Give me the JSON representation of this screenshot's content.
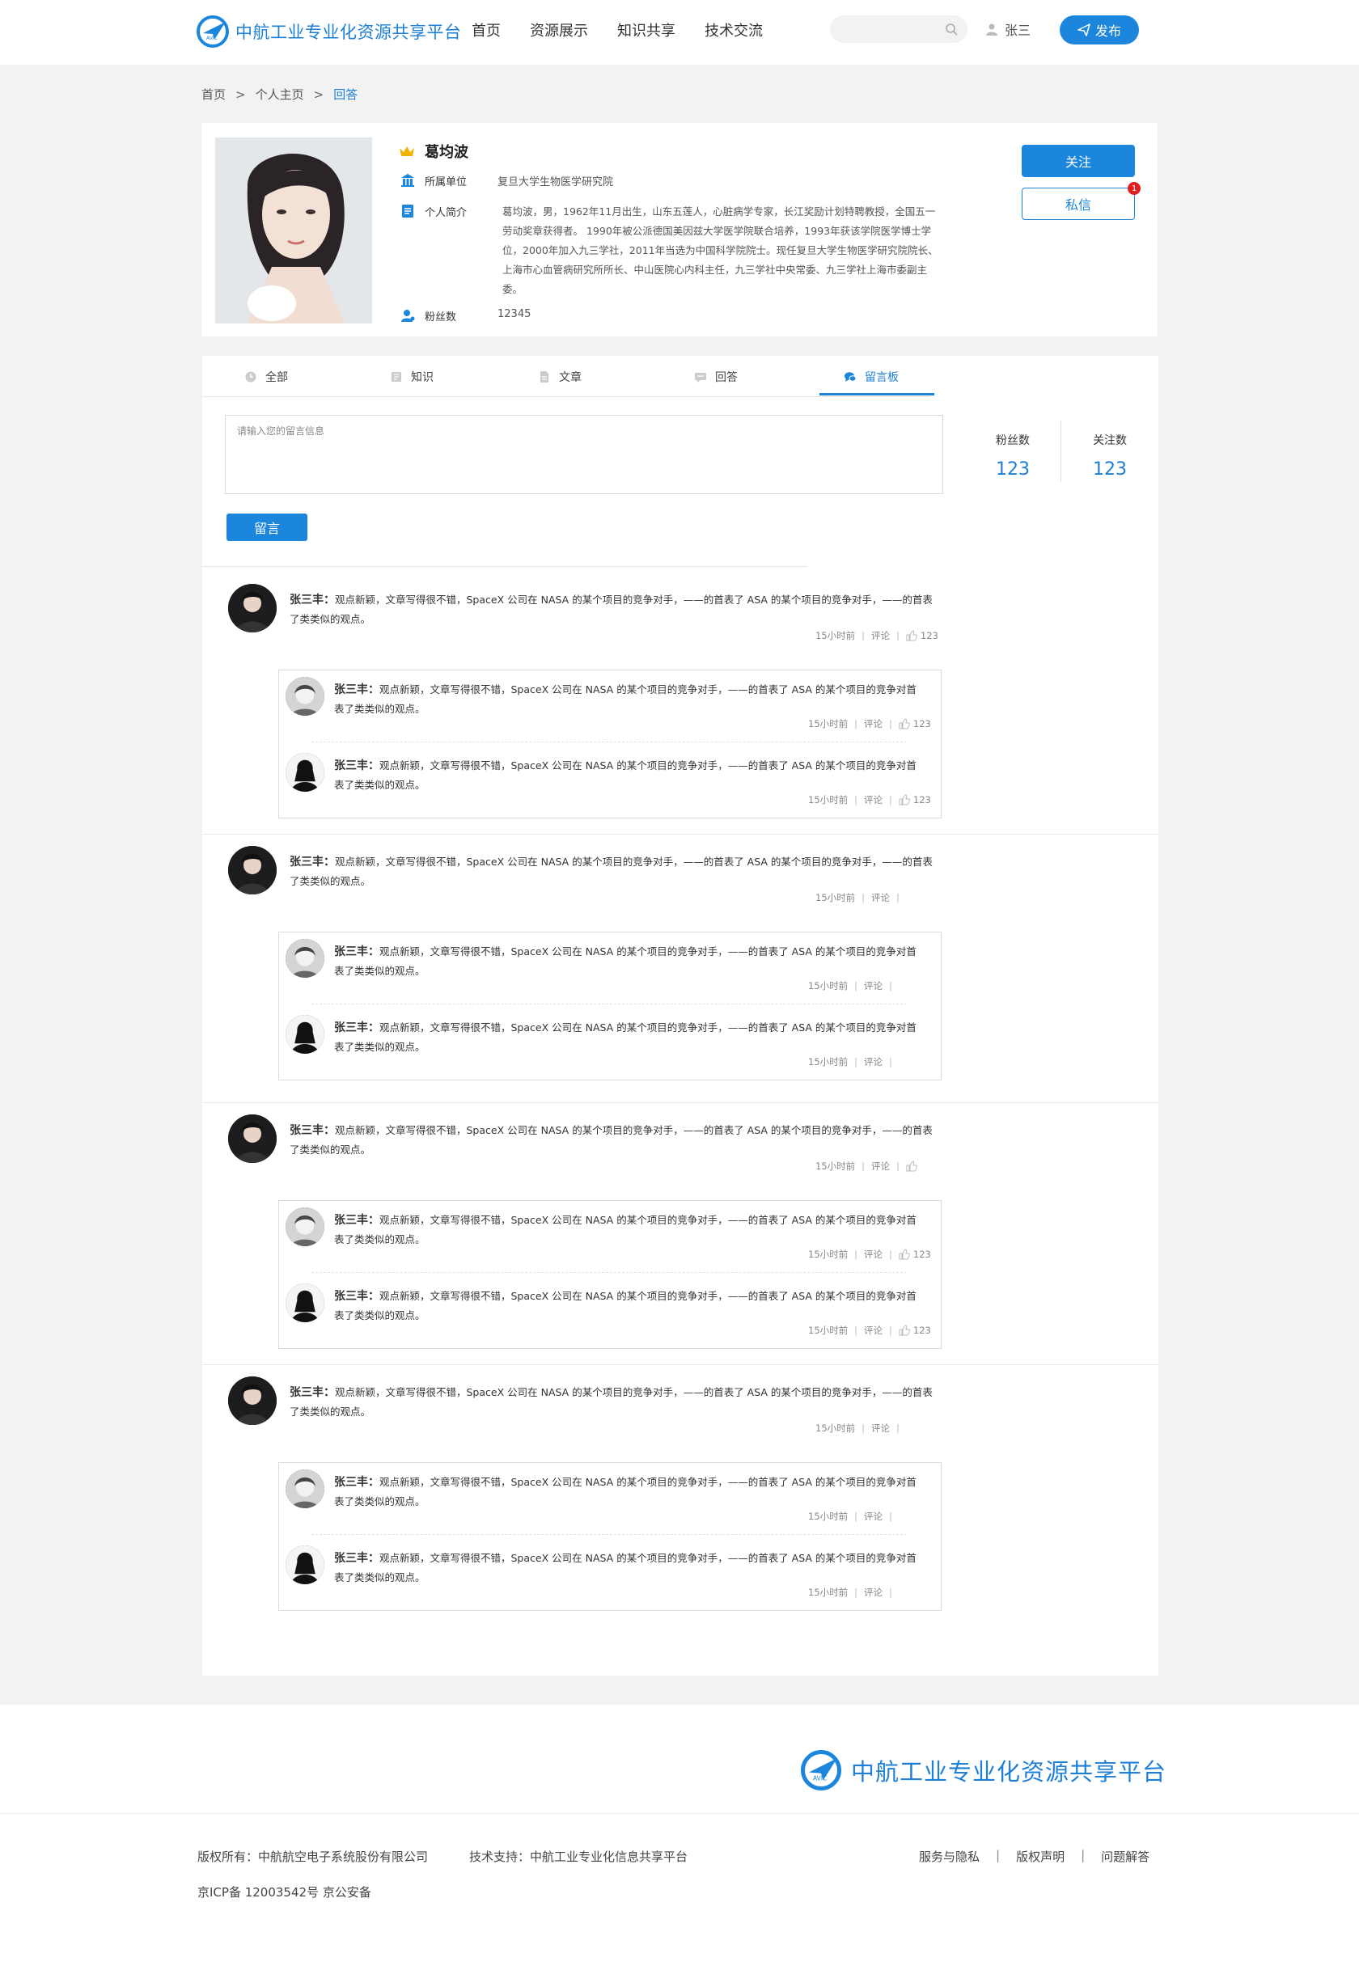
{
  "header": {
    "site_title": "中航工业专业化资源共享平台",
    "nav": [
      "首页",
      "资源展示",
      "知识共享",
      "技术交流"
    ],
    "search_placeholder": "",
    "user_name": "张三",
    "publish_label": "发布",
    "brand_color": "#1c86dd"
  },
  "breadcrumb": [
    "首页",
    "个人主页",
    "回答"
  ],
  "profile": {
    "name": "葛均波",
    "org_label": "所属单位",
    "org_value": "复旦大学生物医学研究院",
    "bio_label": "个人简介",
    "bio_value": "葛均波，男，1962年11月出生，山东五莲人，心脏病学专家，长江奖励计划特聘教授，全国五一劳动奖章获得者。 1990年被公派德国美因兹大学医学院联合培养，1993年获该学院医学博士学位，2000年加入九三学社，2011年当选为中国科学院院士。现任复旦大学生物医学研究院院长、上海市心血管病研究所所长、中山医院心内科主任，九三学社中央常委、九三学社上海市委副主委。",
    "fans_label": "粉丝数",
    "fans_value": "12345",
    "follow_label": "关注",
    "message_label": "私信",
    "message_badge": "1"
  },
  "tabs": [
    {
      "label": "全部",
      "icon": "clock-icon"
    },
    {
      "label": "知识",
      "icon": "book-icon"
    },
    {
      "label": "文章",
      "icon": "document-icon"
    },
    {
      "label": "回答",
      "icon": "answer-icon"
    },
    {
      "label": "留言板",
      "icon": "chat-bubble-icon",
      "active": true
    }
  ],
  "stats": [
    {
      "label": "粉丝数",
      "value": "123"
    },
    {
      "label": "关注数",
      "value": "123"
    }
  ],
  "message_board": {
    "placeholder": "请输入您的留言信息",
    "submit_label": "留言"
  },
  "comments": [
    {
      "author": "张三丰：",
      "text": "观点新颖，文章写得很不错，SpaceX 公司在 NASA 的某个项目的竞争对手，——的首表了 ASA 的某个项目的竞争对手，——的首表了类类似的观点。",
      "time": "15小时前",
      "comment_label": "评论",
      "likes": "123",
      "replies": [
        {
          "author": "张三丰：",
          "text": "观点新颖，文章写得很不错，SpaceX 公司在 NASA 的某个项目的竞争对手，——的首表了 ASA 的某个项目的竞争对首表了类类似的观点。",
          "time": "15小时前",
          "comment_label": "评论",
          "likes": "123"
        },
        {
          "author": "张三丰：",
          "text": "观点新颖，文章写得很不错，SpaceX 公司在 NASA 的某个项目的竞争对手，——的首表了 ASA 的某个项目的竞争对首表了类类似的观点。",
          "time": "15小时前",
          "comment_label": "评论",
          "likes": "123"
        }
      ]
    },
    {
      "author": "张三丰：",
      "text": "观点新颖，文章写得很不错，SpaceX 公司在 NASA 的某个项目的竞争对手，——的首表了 ASA 的某个项目的竞争对手，——的首表了类类似的观点。",
      "time": "15小时前",
      "comment_label": "评论",
      "likes": "",
      "replies": [
        {
          "author": "张三丰：",
          "text": "观点新颖，文章写得很不错，SpaceX 公司在 NASA 的某个项目的竞争对手，——的首表了 ASA 的某个项目的竞争对首表了类类似的观点。",
          "time": "15小时前",
          "comment_label": "评论",
          "likes": ""
        },
        {
          "author": "张三丰：",
          "text": "观点新颖，文章写得很不错，SpaceX 公司在 NASA 的某个项目的竞争对手，——的首表了 ASA 的某个项目的竞争对首表了类类似的观点。",
          "time": "15小时前",
          "comment_label": "评论",
          "likes": ""
        }
      ]
    },
    {
      "author": "张三丰：",
      "text": "观点新颖，文章写得很不错，SpaceX 公司在 NASA 的某个项目的竞争对手，——的首表了 ASA 的某个项目的竞争对手，——的首表了类类似的观点。",
      "time": "15小时前",
      "comment_label": "评论",
      "likes": "",
      "replies": [
        {
          "author": "张三丰：",
          "text": "观点新颖，文章写得很不错，SpaceX 公司在 NASA 的某个项目的竞争对手，——的首表了 ASA 的某个项目的竞争对首表了类类似的观点。",
          "time": "15小时前",
          "comment_label": "评论",
          "likes": "123"
        },
        {
          "author": "张三丰：",
          "text": "观点新颖，文章写得很不错，SpaceX 公司在 NASA 的某个项目的竞争对手，——的首表了 ASA 的某个项目的竞争对首表了类类似的观点。",
          "time": "15小时前",
          "comment_label": "评论",
          "likes": "123"
        }
      ]
    },
    {
      "author": "张三丰：",
      "text": "观点新颖，文章写得很不错，SpaceX 公司在 NASA 的某个项目的竞争对手，——的首表了 ASA 的某个项目的竞争对手，——的首表了类类似的观点。",
      "time": "15小时前",
      "comment_label": "评论",
      "likes": "",
      "replies": [
        {
          "author": "张三丰：",
          "text": "观点新颖，文章写得很不错，SpaceX 公司在 NASA 的某个项目的竞争对手，——的首表了 ASA 的某个项目的竞争对首表了类类似的观点。",
          "time": "15小时前",
          "comment_label": "评论",
          "likes": ""
        },
        {
          "author": "张三丰：",
          "text": "观点新颖，文章写得很不错，SpaceX 公司在 NASA 的某个项目的竞争对手，——的首表了 ASA 的某个项目的竞争对首表了类类似的观点。",
          "time": "15小时前",
          "comment_label": "评论",
          "likes": ""
        }
      ]
    }
  ],
  "footer": {
    "site_title": "中航工业专业化资源共享平台",
    "copyright": "版权所有：中航航空电子系统股份有限公司",
    "tech_support": "技术支持：中航工业专业化信息共享平台",
    "icp": "京ICP备 12003542号 京公安备",
    "links": [
      "服务与隐私",
      "版权声明",
      "问题解答"
    ]
  }
}
